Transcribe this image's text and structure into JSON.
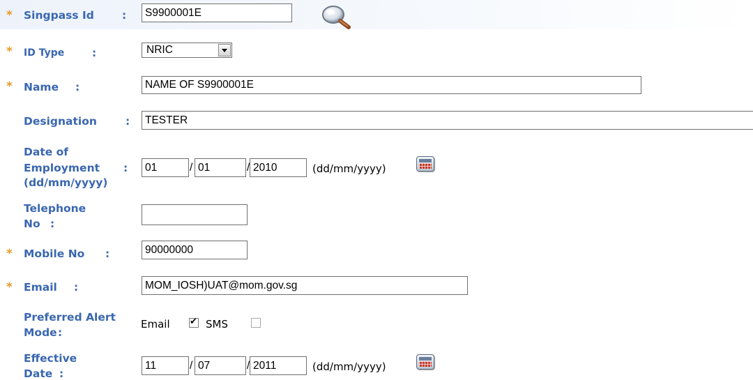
{
  "fields": {
    "singpass_id": {
      "label": "Singpass Id",
      "colon": ":",
      "value": "S9900001E"
    },
    "id_type": {
      "label": "ID Type",
      "colon": ":",
      "selected": "NRIC"
    },
    "name": {
      "label": "Name",
      "colon": ":",
      "value": "NAME OF S9900001E"
    },
    "designation": {
      "label": "Designation",
      "colon": ":",
      "value": "TESTER"
    },
    "date_of_employment": {
      "label_line1": "Date of",
      "label_line2": "Employment",
      "label_line3": "(dd/mm/yyyy)",
      "colon": ":",
      "day": "01",
      "month": "01",
      "year": "2010",
      "format_hint": "(dd/mm/yyyy)"
    },
    "telephone": {
      "label_line1": "Telephone",
      "label_line2": "No",
      "colon": ":",
      "value": ""
    },
    "mobile": {
      "label": "Mobile No",
      "colon": ":",
      "value": "90000000"
    },
    "email": {
      "label": "Email",
      "colon": ":",
      "value": "MOM_IOSH)UAT@mom.gov.sg"
    },
    "preferred_alert_mode": {
      "label_line1": "Preferred Alert",
      "label_line2": "Mode",
      "colon": ":",
      "email_label": "Email",
      "email_checked": true,
      "sms_label": "SMS",
      "sms_checked": false
    },
    "effective_date": {
      "label_line1": "Effective",
      "label_line2": "Date",
      "colon": ":",
      "day": "11",
      "month": "07",
      "year": "2011",
      "format_hint": "(dd/mm/yyyy)"
    }
  },
  "required_marker": "*",
  "date_separator": "/",
  "icons": {
    "search": "magnifier-search-icon",
    "calendar": "calendar-icon"
  },
  "colors": {
    "label": "#3a67b0",
    "required": "#e69a28"
  }
}
